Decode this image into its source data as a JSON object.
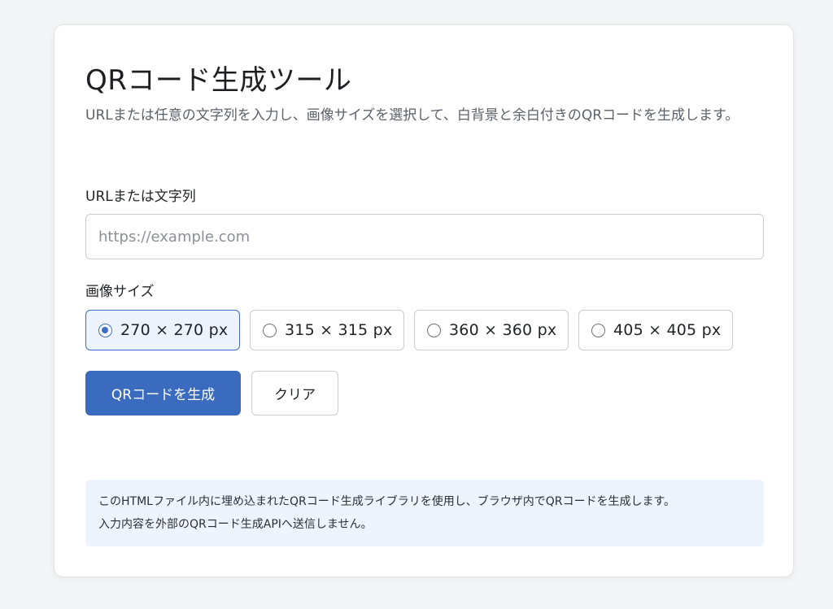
{
  "header": {
    "title": "QRコード生成ツール",
    "description": "URLまたは任意の文字列を入力し、画像サイズを選択して、白背景と余白付きのQRコードを生成します。"
  },
  "url_field": {
    "label": "URLまたは文字列",
    "placeholder": "https://example.com",
    "value": ""
  },
  "size_field": {
    "label": "画像サイズ",
    "options": [
      {
        "label": "270 × 270 px",
        "selected": true
      },
      {
        "label": "315 × 315 px",
        "selected": false
      },
      {
        "label": "360 × 360 px",
        "selected": false
      },
      {
        "label": "405 × 405 px",
        "selected": false
      }
    ]
  },
  "actions": {
    "generate_label": "QRコードを生成",
    "clear_label": "クリア"
  },
  "note": {
    "line1": "このHTMLファイル内に埋め込まれたQRコード生成ライブラリを使用し、ブラウザ内でQRコードを生成します。",
    "line2": "入力内容を外部のQRコード生成APIへ送信しません。"
  },
  "colors": {
    "accent": "#3a6bbf",
    "selected_bg": "#edf3fd",
    "note_bg": "#eef4fd",
    "page_bg": "#f3f4f6"
  }
}
